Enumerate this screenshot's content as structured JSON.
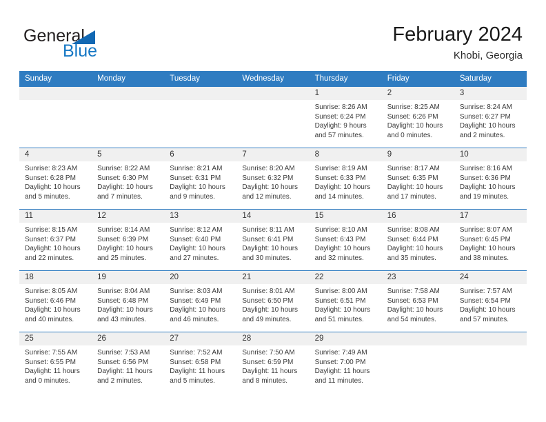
{
  "brand": {
    "name_top": "General",
    "name_bottom": "Blue",
    "triangle_icon": "logo-triangle-icon",
    "accent_color": "#1577c4"
  },
  "header": {
    "title": "February 2024",
    "subtitle": "Khobi, Georgia"
  },
  "theme": {
    "header_bar": "#2f7cc1",
    "daynum_band": "#f0f0f0",
    "text": "#3a3a3a"
  },
  "weekdays": [
    "Sunday",
    "Monday",
    "Tuesday",
    "Wednesday",
    "Thursday",
    "Friday",
    "Saturday"
  ],
  "weeks": [
    [
      {
        "day": "",
        "sunrise": "",
        "sunset": "",
        "daylight1": "",
        "daylight2": ""
      },
      {
        "day": "",
        "sunrise": "",
        "sunset": "",
        "daylight1": "",
        "daylight2": ""
      },
      {
        "day": "",
        "sunrise": "",
        "sunset": "",
        "daylight1": "",
        "daylight2": ""
      },
      {
        "day": "",
        "sunrise": "",
        "sunset": "",
        "daylight1": "",
        "daylight2": ""
      },
      {
        "day": "1",
        "sunrise": "Sunrise: 8:26 AM",
        "sunset": "Sunset: 6:24 PM",
        "daylight1": "Daylight: 9 hours",
        "daylight2": "and 57 minutes."
      },
      {
        "day": "2",
        "sunrise": "Sunrise: 8:25 AM",
        "sunset": "Sunset: 6:26 PM",
        "daylight1": "Daylight: 10 hours",
        "daylight2": "and 0 minutes."
      },
      {
        "day": "3",
        "sunrise": "Sunrise: 8:24 AM",
        "sunset": "Sunset: 6:27 PM",
        "daylight1": "Daylight: 10 hours",
        "daylight2": "and 2 minutes."
      }
    ],
    [
      {
        "day": "4",
        "sunrise": "Sunrise: 8:23 AM",
        "sunset": "Sunset: 6:28 PM",
        "daylight1": "Daylight: 10 hours",
        "daylight2": "and 5 minutes."
      },
      {
        "day": "5",
        "sunrise": "Sunrise: 8:22 AM",
        "sunset": "Sunset: 6:30 PM",
        "daylight1": "Daylight: 10 hours",
        "daylight2": "and 7 minutes."
      },
      {
        "day": "6",
        "sunrise": "Sunrise: 8:21 AM",
        "sunset": "Sunset: 6:31 PM",
        "daylight1": "Daylight: 10 hours",
        "daylight2": "and 9 minutes."
      },
      {
        "day": "7",
        "sunrise": "Sunrise: 8:20 AM",
        "sunset": "Sunset: 6:32 PM",
        "daylight1": "Daylight: 10 hours",
        "daylight2": "and 12 minutes."
      },
      {
        "day": "8",
        "sunrise": "Sunrise: 8:19 AM",
        "sunset": "Sunset: 6:33 PM",
        "daylight1": "Daylight: 10 hours",
        "daylight2": "and 14 minutes."
      },
      {
        "day": "9",
        "sunrise": "Sunrise: 8:17 AM",
        "sunset": "Sunset: 6:35 PM",
        "daylight1": "Daylight: 10 hours",
        "daylight2": "and 17 minutes."
      },
      {
        "day": "10",
        "sunrise": "Sunrise: 8:16 AM",
        "sunset": "Sunset: 6:36 PM",
        "daylight1": "Daylight: 10 hours",
        "daylight2": "and 19 minutes."
      }
    ],
    [
      {
        "day": "11",
        "sunrise": "Sunrise: 8:15 AM",
        "sunset": "Sunset: 6:37 PM",
        "daylight1": "Daylight: 10 hours",
        "daylight2": "and 22 minutes."
      },
      {
        "day": "12",
        "sunrise": "Sunrise: 8:14 AM",
        "sunset": "Sunset: 6:39 PM",
        "daylight1": "Daylight: 10 hours",
        "daylight2": "and 25 minutes."
      },
      {
        "day": "13",
        "sunrise": "Sunrise: 8:12 AM",
        "sunset": "Sunset: 6:40 PM",
        "daylight1": "Daylight: 10 hours",
        "daylight2": "and 27 minutes."
      },
      {
        "day": "14",
        "sunrise": "Sunrise: 8:11 AM",
        "sunset": "Sunset: 6:41 PM",
        "daylight1": "Daylight: 10 hours",
        "daylight2": "and 30 minutes."
      },
      {
        "day": "15",
        "sunrise": "Sunrise: 8:10 AM",
        "sunset": "Sunset: 6:43 PM",
        "daylight1": "Daylight: 10 hours",
        "daylight2": "and 32 minutes."
      },
      {
        "day": "16",
        "sunrise": "Sunrise: 8:08 AM",
        "sunset": "Sunset: 6:44 PM",
        "daylight1": "Daylight: 10 hours",
        "daylight2": "and 35 minutes."
      },
      {
        "day": "17",
        "sunrise": "Sunrise: 8:07 AM",
        "sunset": "Sunset: 6:45 PM",
        "daylight1": "Daylight: 10 hours",
        "daylight2": "and 38 minutes."
      }
    ],
    [
      {
        "day": "18",
        "sunrise": "Sunrise: 8:05 AM",
        "sunset": "Sunset: 6:46 PM",
        "daylight1": "Daylight: 10 hours",
        "daylight2": "and 40 minutes."
      },
      {
        "day": "19",
        "sunrise": "Sunrise: 8:04 AM",
        "sunset": "Sunset: 6:48 PM",
        "daylight1": "Daylight: 10 hours",
        "daylight2": "and 43 minutes."
      },
      {
        "day": "20",
        "sunrise": "Sunrise: 8:03 AM",
        "sunset": "Sunset: 6:49 PM",
        "daylight1": "Daylight: 10 hours",
        "daylight2": "and 46 minutes."
      },
      {
        "day": "21",
        "sunrise": "Sunrise: 8:01 AM",
        "sunset": "Sunset: 6:50 PM",
        "daylight1": "Daylight: 10 hours",
        "daylight2": "and 49 minutes."
      },
      {
        "day": "22",
        "sunrise": "Sunrise: 8:00 AM",
        "sunset": "Sunset: 6:51 PM",
        "daylight1": "Daylight: 10 hours",
        "daylight2": "and 51 minutes."
      },
      {
        "day": "23",
        "sunrise": "Sunrise: 7:58 AM",
        "sunset": "Sunset: 6:53 PM",
        "daylight1": "Daylight: 10 hours",
        "daylight2": "and 54 minutes."
      },
      {
        "day": "24",
        "sunrise": "Sunrise: 7:57 AM",
        "sunset": "Sunset: 6:54 PM",
        "daylight1": "Daylight: 10 hours",
        "daylight2": "and 57 minutes."
      }
    ],
    [
      {
        "day": "25",
        "sunrise": "Sunrise: 7:55 AM",
        "sunset": "Sunset: 6:55 PM",
        "daylight1": "Daylight: 11 hours",
        "daylight2": "and 0 minutes."
      },
      {
        "day": "26",
        "sunrise": "Sunrise: 7:53 AM",
        "sunset": "Sunset: 6:56 PM",
        "daylight1": "Daylight: 11 hours",
        "daylight2": "and 2 minutes."
      },
      {
        "day": "27",
        "sunrise": "Sunrise: 7:52 AM",
        "sunset": "Sunset: 6:58 PM",
        "daylight1": "Daylight: 11 hours",
        "daylight2": "and 5 minutes."
      },
      {
        "day": "28",
        "sunrise": "Sunrise: 7:50 AM",
        "sunset": "Sunset: 6:59 PM",
        "daylight1": "Daylight: 11 hours",
        "daylight2": "and 8 minutes."
      },
      {
        "day": "29",
        "sunrise": "Sunrise: 7:49 AM",
        "sunset": "Sunset: 7:00 PM",
        "daylight1": "Daylight: 11 hours",
        "daylight2": "and 11 minutes."
      },
      {
        "day": "",
        "sunrise": "",
        "sunset": "",
        "daylight1": "",
        "daylight2": ""
      },
      {
        "day": "",
        "sunrise": "",
        "sunset": "",
        "daylight1": "",
        "daylight2": ""
      }
    ]
  ]
}
